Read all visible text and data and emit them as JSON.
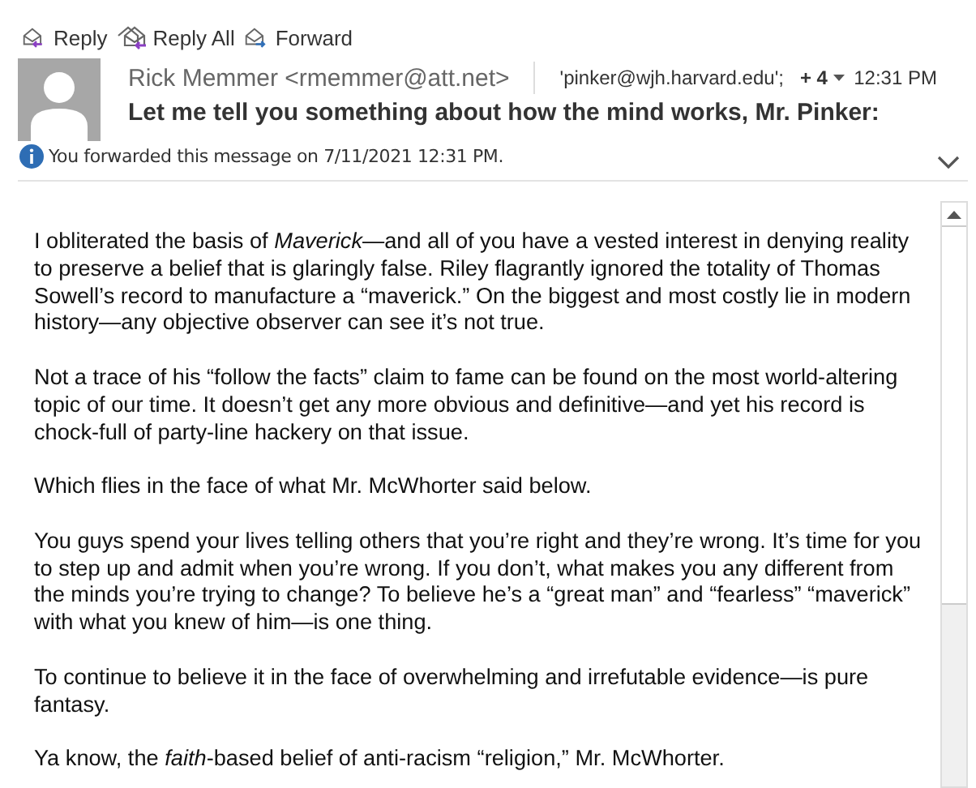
{
  "toolbar": [
    {
      "label": "Reply",
      "kind": "reply"
    },
    {
      "label": "Reply All",
      "kind": "replyall"
    },
    {
      "label": "Forward",
      "kind": "forward"
    }
  ],
  "header": {
    "sender": "Rick Memmer <rmemmer@att.net>",
    "recipients": "'pinker@wjh.harvard.edu';",
    "more_recipients": "+ 4",
    "time": "12:31 PM",
    "subject": "Let me tell you something about how the mind works, Mr. Pinker:",
    "info": "You forwarded this message on 7/11/2021 12:31 PM."
  },
  "body": {
    "paragraphs": [
      "I obliterated the basis of *Maverick*—and all of you have a vested interest in denying reality to preserve a belief that is glaringly false. Riley flagrantly ignored the totality of Thomas Sowell’s record to manufacture a “maverick.” On the biggest and most costly lie in modern history—any objective observer can see it’s not true.",
      "Not a trace of his “follow the facts” claim to fame can be found on the most world-altering topic of our time. It doesn’t get any more obvious and definitive—and yet his record is chock-full of party-line hackery on that issue.",
      "Which flies in the face of what Mr. McWhorter said below.",
      "You guys spend your lives telling others that you’re right and they’re wrong. It’s time for you to step up and admit when you’re wrong. If you don’t, what makes you any different from the minds you’re trying to change? To believe he’s a “great man” and “fearless” “maverick” with what you knew of him—is one thing.",
      "To continue to believe it in the face of overwhelming and irrefutable evidence—is pure fantasy.",
      "Ya know, the *faith*-based belief of anti-racism “religion,” Mr. McWhorter."
    ]
  }
}
